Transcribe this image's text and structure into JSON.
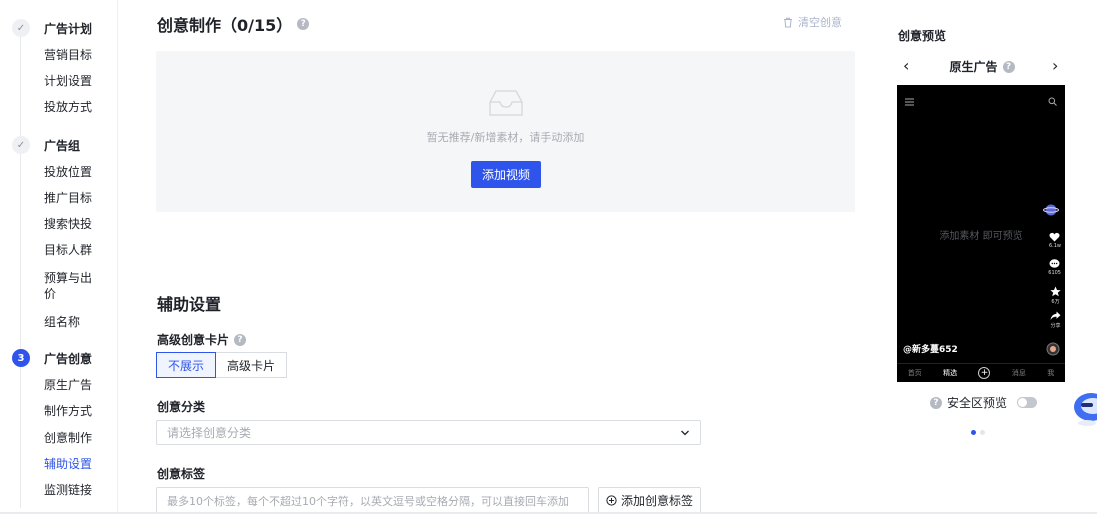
{
  "sidebar": {
    "steps": [
      {
        "marker": "✓",
        "title": "广告计划",
        "items": [
          "营销目标",
          "计划设置",
          "投放方式"
        ]
      },
      {
        "marker": "✓",
        "title": "广告组",
        "items": [
          "投放位置",
          "推广目标",
          "搜索快投",
          "目标人群",
          "预算与出价",
          "组名称"
        ]
      },
      {
        "marker": "3",
        "title": "广告创意",
        "items": [
          "原生广告",
          "制作方式",
          "创意制作",
          "辅助设置",
          "监测链接"
        ]
      }
    ],
    "current_item": "辅助设置"
  },
  "creative": {
    "title": "创意制作（0/15）",
    "clear_label": "清空创意",
    "empty_text": "暂无推荐/新增素材，请手动添加",
    "add_video_label": "添加视频"
  },
  "aux": {
    "title": "辅助设置",
    "card_label": "高级创意卡片",
    "card_options": [
      "不展示",
      "高级卡片"
    ],
    "card_selected": "不展示",
    "category_label": "创意分类",
    "category_placeholder": "请选择创意分类",
    "tag_label": "创意标签",
    "tag_placeholder": "最多10个标签，每个不超过10个字符，以英文逗号或空格分隔，可以直接回车添加",
    "tag_button": "添加创意标签"
  },
  "preview": {
    "title": "创意预览",
    "placement": "原生广告",
    "center_text": "添加素材 即可预览",
    "username": "@新多蔓652",
    "tabs": [
      "首页",
      "精选",
      "+",
      "消息",
      "我"
    ],
    "active_tab": "精选",
    "side_counts": [
      "6.1w",
      "6105",
      "6万",
      "分享"
    ],
    "safe_area_label": "安全区预览",
    "safe_area_on": false
  },
  "colors": {
    "accent": "#2f54eb",
    "empty_bg": "#f5f6f8",
    "phone_bg": "#000000"
  }
}
